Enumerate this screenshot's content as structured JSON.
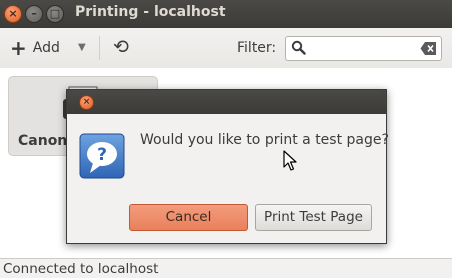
{
  "window": {
    "title": "Printing - localhost",
    "close_glyph": "×",
    "minimize_glyph": "–",
    "maximize_glyph": "□"
  },
  "toolbar": {
    "add_label": "Add",
    "add_icon": "plus-icon",
    "dropdown_icon": "chevron-down-icon",
    "refresh_icon": "refresh-icon",
    "filter_label": "Filter:",
    "filter_value": ""
  },
  "printers": [
    {
      "name": "Canon-i"
    }
  ],
  "dialog": {
    "message": "Would you like to print a test page?",
    "cancel_label": "Cancel",
    "print_test_label": "Print Test Page",
    "close_glyph": "×",
    "icon": "question-icon"
  },
  "statusbar": {
    "text": "Connected to localhost"
  },
  "colors": {
    "titlebar": "#3c3b37",
    "accent": "#e9805c",
    "close_orange": "#e35a1c"
  }
}
